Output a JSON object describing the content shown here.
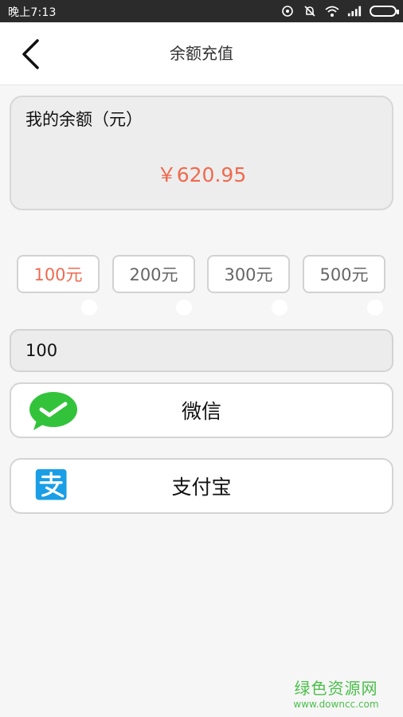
{
  "status_bar": {
    "time": "晚上7:13"
  },
  "header": {
    "title": "余额充值"
  },
  "balance": {
    "label": "我的余额（元）",
    "amount": "￥620.95"
  },
  "options": [
    {
      "label": "100元",
      "selected": true
    },
    {
      "label": "200元",
      "selected": false
    },
    {
      "label": "300元",
      "selected": false
    },
    {
      "label": "500元",
      "selected": false
    }
  ],
  "amount_input": {
    "value": "100"
  },
  "payments": {
    "wechat": {
      "label": "微信",
      "icon": "wechat-icon"
    },
    "alipay": {
      "label": "支付宝",
      "icon": "alipay-icon"
    }
  },
  "watermark": {
    "title": "绿色资源网",
    "url": "www.downcc.com"
  },
  "colors": {
    "accent": "#ef6a4f",
    "wechat": "#33c33b",
    "alipay": "#1a9ee6",
    "watermark": "#4bbf4b"
  }
}
